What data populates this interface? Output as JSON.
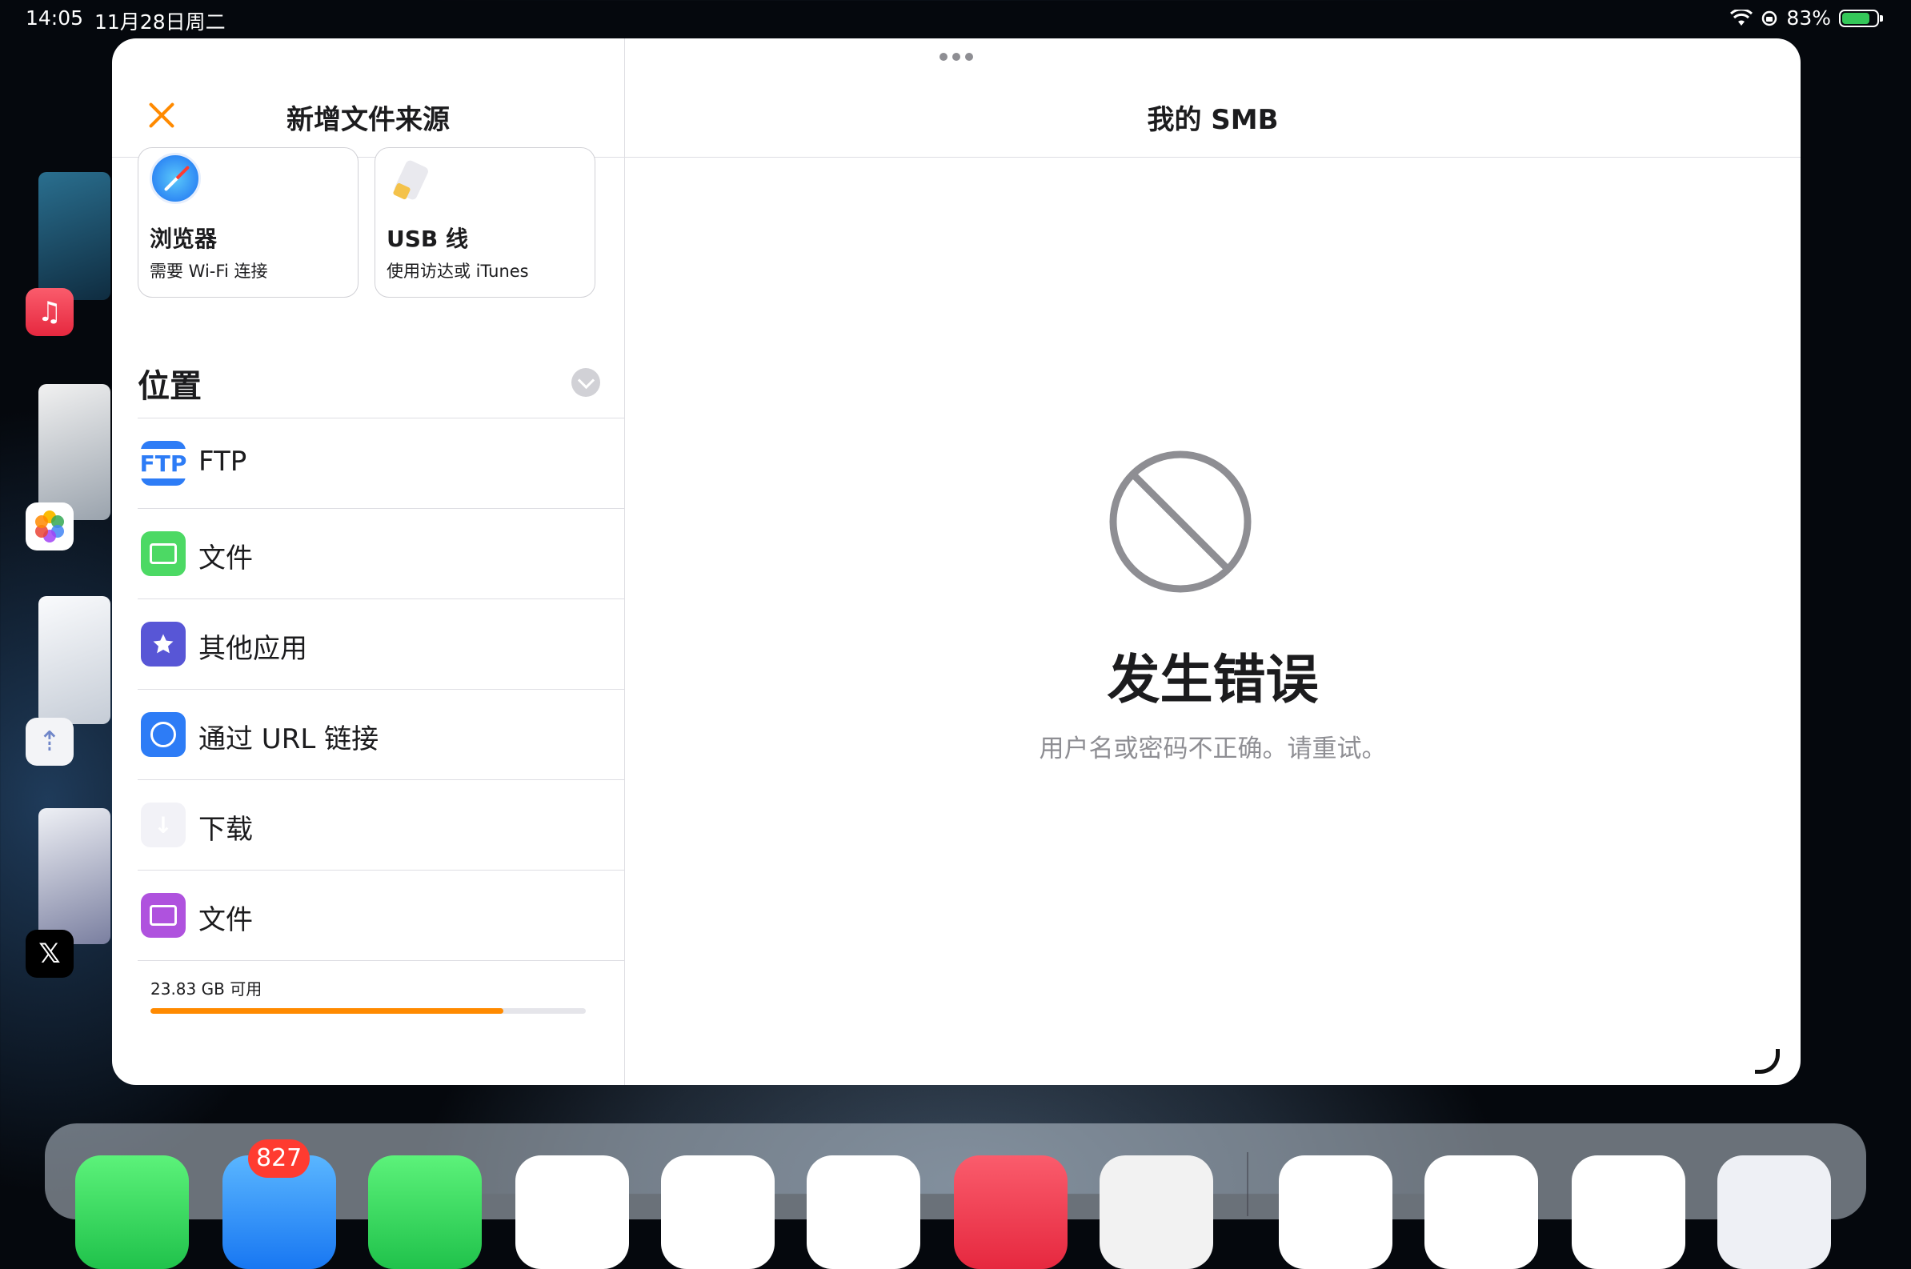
{
  "status_bar": {
    "time": "14:05",
    "date": "11月28日周二",
    "battery_percent": "83%",
    "battery_level": 0.83
  },
  "left_pane": {
    "title": "新增文件来源",
    "cards": [
      {
        "title": "浏览器",
        "subtitle": "需要 Wi-Fi 连接",
        "icon": "safari-icon"
      },
      {
        "title": "USB 线",
        "subtitle": "使用访达或 iTunes",
        "icon": "usb-cable-icon"
      }
    ],
    "section_title": "位置",
    "locations": [
      {
        "label": "FTP",
        "icon": "ftp-icon",
        "badge_text": "FTP"
      },
      {
        "label": "文件",
        "icon": "files-folder-icon"
      },
      {
        "label": "其他应用",
        "icon": "star-icon"
      },
      {
        "label": "通过 URL 链接",
        "icon": "globe-icon"
      },
      {
        "label": "下载",
        "icon": "download-arrow-icon",
        "glyph": "↓"
      },
      {
        "label": "文件",
        "icon": "purple-folder-icon"
      }
    ],
    "storage": {
      "label": "23.83 GB 可用",
      "used_fraction": 0.81
    }
  },
  "right_pane": {
    "title": "我的 SMB",
    "error_title": "发生错误",
    "error_message": "用户名或密码不正确。请重试。"
  },
  "dock": {
    "mail_badge": "827"
  },
  "colors": {
    "accent": "#ff8a00",
    "error_icon": "#8e8e93"
  }
}
